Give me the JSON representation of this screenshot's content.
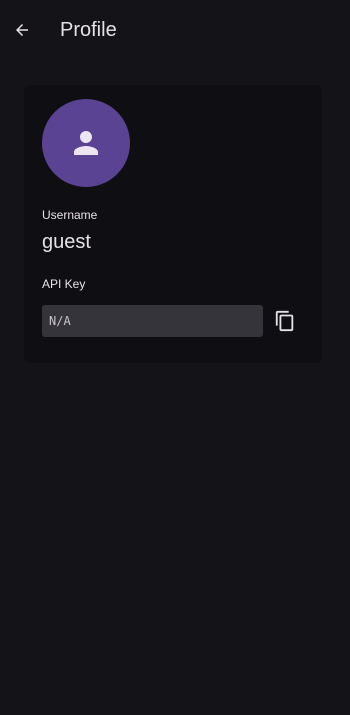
{
  "app_bar": {
    "title": "Profile",
    "back_icon": "arrow-back-icon"
  },
  "profile": {
    "avatar_icon": "person-icon",
    "avatar_color": "#5b4394",
    "username_label": "Username",
    "username": "guest",
    "api_key_label": "API Key",
    "api_key_value": "N/A",
    "copy_icon": "copy-icon"
  }
}
